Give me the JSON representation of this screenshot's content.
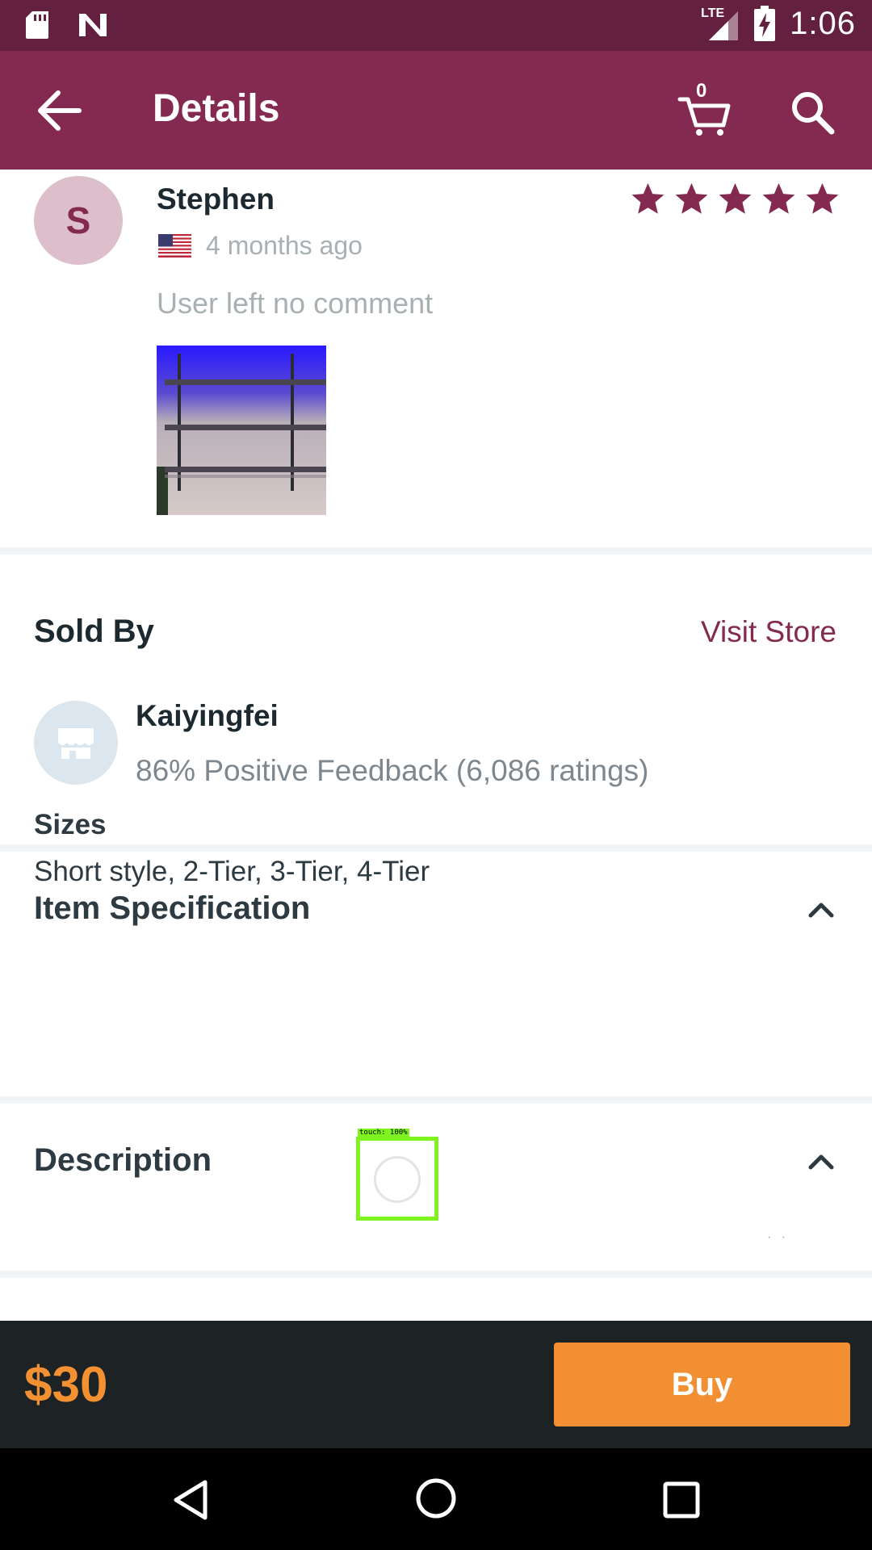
{
  "status_bar": {
    "time": "1:06",
    "network": "LTE",
    "icons": [
      "sd-card-icon",
      "n-notification-icon",
      "signal-icon",
      "battery-charging-icon"
    ]
  },
  "app_bar": {
    "title": "Details",
    "cart_count": "0",
    "icons": [
      "back-arrow-icon",
      "cart-icon",
      "search-icon"
    ]
  },
  "review": {
    "avatar_initial": "S",
    "reviewer": "Stephen",
    "time_ago": "4 months ago",
    "rating": 5,
    "rating_max": 5,
    "comment": "User left no comment",
    "flag": "us-flag-icon"
  },
  "sold_by": {
    "title": "Sold By",
    "visit_store": "Visit Store",
    "store_name": "Kaiyingfei",
    "feedback": "86% Positive Feedback (6,086 ratings)"
  },
  "item_spec": {
    "title": "Item Specification",
    "label": "Sizes",
    "value": "Short style, 2-Tier, 3-Tier, 4-Tier"
  },
  "description": {
    "title": "Description",
    "touch_label": "touch: 100%"
  },
  "bottom": {
    "price": "$30",
    "buy_label": "Buy"
  },
  "colors": {
    "status_bar": "#64203f",
    "app_bar": "#84294f",
    "accent": "#84294f",
    "price": "#f39132",
    "buy_button": "#f18f32",
    "bottom_bar": "#1d2225"
  }
}
